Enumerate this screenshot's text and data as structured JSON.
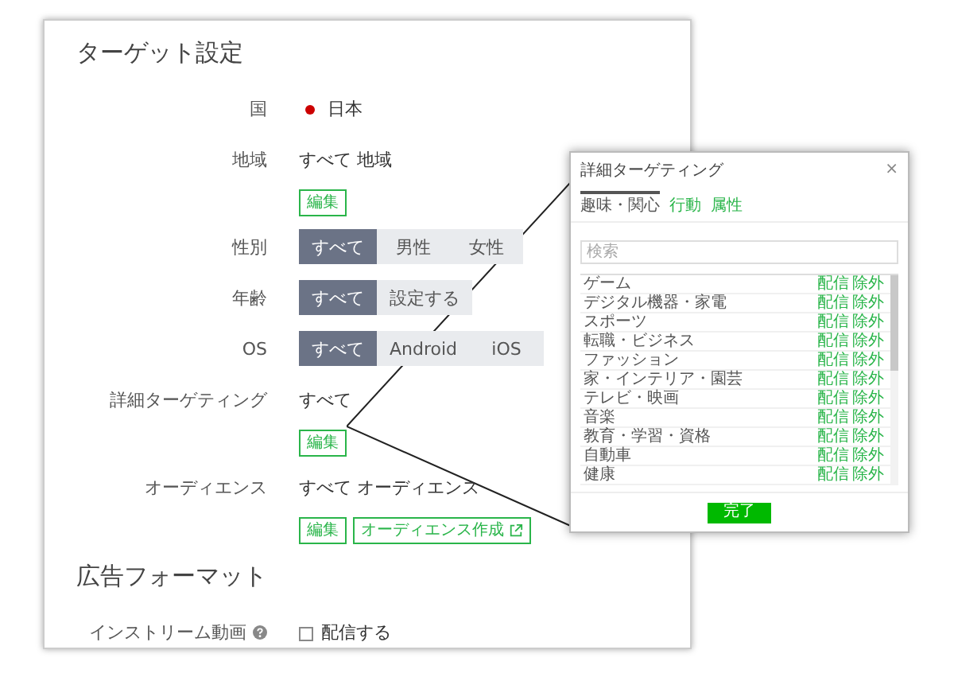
{
  "sections": [
    {
      "title": "ターゲット設定",
      "rows": [
        {
          "kind": "dot",
          "label": "国",
          "value": "日本"
        },
        {
          "kind": "text",
          "label": "地域",
          "value": "すべて 地域",
          "buttons": [
            {
              "label": "編集",
              "external": false
            }
          ]
        },
        {
          "kind": "segmented",
          "label": "性別",
          "options": [
            {
              "label": "すべて",
              "selected": true
            },
            {
              "label": "男性",
              "selected": false
            },
            {
              "label": "女性",
              "selected": false
            }
          ]
        },
        {
          "kind": "segmented",
          "label": "年齢",
          "options": [
            {
              "label": "すべて",
              "selected": true
            },
            {
              "label": "設定する",
              "selected": false
            }
          ]
        },
        {
          "kind": "segmented",
          "label": "OS",
          "options": [
            {
              "label": "すべて",
              "selected": true
            },
            {
              "label": "Android",
              "selected": false
            },
            {
              "label": "iOS",
              "selected": false
            }
          ]
        },
        {
          "kind": "text",
          "label": "詳細ターゲティング",
          "value": "すべて",
          "buttons": [
            {
              "label": "編集",
              "external": false
            }
          ]
        },
        {
          "kind": "text",
          "label": "オーディエンス",
          "value": "すべて オーディエンス",
          "buttons": [
            {
              "label": "編集",
              "external": false
            },
            {
              "label": "オーディエンス作成",
              "external": true
            }
          ]
        }
      ]
    },
    {
      "title": "広告フォーマット",
      "rows": [
        {
          "kind": "checkbox",
          "label": "インストリーム動画",
          "value": "配信する",
          "checked": false
        }
      ]
    }
  ],
  "popup": {
    "title": "詳細ターゲティング",
    "close": "×",
    "tabs": [
      {
        "label": "趣味・関心",
        "selected": true
      },
      {
        "label": "行動",
        "selected": false
      },
      {
        "label": "属性",
        "selected": false
      }
    ],
    "search": {
      "placeholder": "検索"
    },
    "items": [
      {
        "label": "ゲーム",
        "actions": [
          "配信",
          "除外"
        ]
      },
      {
        "label": "デジタル機器・家電",
        "actions": [
          "配信",
          "除外"
        ]
      },
      {
        "label": "スポーツ",
        "actions": [
          "配信",
          "除外"
        ]
      },
      {
        "label": "転職・ビジネス",
        "actions": [
          "配信",
          "除外"
        ]
      },
      {
        "label": "ファッション",
        "actions": [
          "配信",
          "除外"
        ]
      },
      {
        "label": "家・インテリア・園芸",
        "actions": [
          "配信",
          "除外"
        ]
      },
      {
        "label": "テレビ・映画",
        "actions": [
          "配信",
          "除外"
        ]
      },
      {
        "label": "音楽",
        "actions": [
          "配信",
          "除外"
        ]
      },
      {
        "label": "教育・学習・資格",
        "actions": [
          "配信",
          "除外"
        ]
      },
      {
        "label": "自動車",
        "actions": [
          "配信",
          "除外"
        ]
      },
      {
        "label": "健康",
        "actions": [
          "配信",
          "除外"
        ]
      }
    ],
    "done": "完了"
  }
}
